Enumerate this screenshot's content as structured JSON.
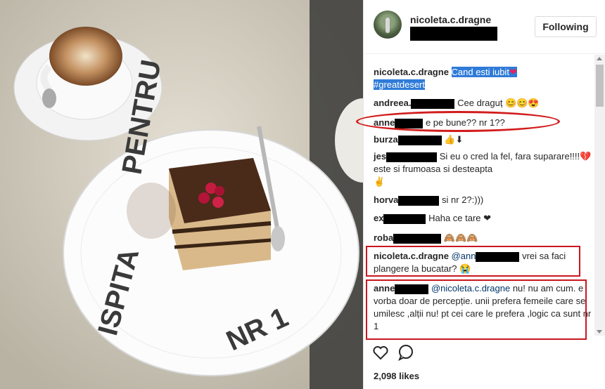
{
  "post": {
    "username": "nicoleta.c.dragne",
    "follow_label": "Following",
    "likes": "2,098 likes"
  },
  "plate_text": "PENTRU ISPITA NR 1",
  "caption": {
    "username": "nicoleta.c.dragne",
    "text": "Cand esti iubit",
    "heart": "❤",
    "hashtag": "#greatdesert"
  },
  "comments": [
    {
      "user": "andreea.",
      "text": "Cee draguț",
      "emoji": "😊😊😍"
    },
    {
      "user": "anne",
      "text": "e pe bune?? nr 1??"
    },
    {
      "user": "burza",
      "text": "",
      "emoji": "👍⬇"
    },
    {
      "user": "jes",
      "text": "Si eu o cred la fel, fara suparare!!!!",
      "tail": " este si frumoasa si desteapta",
      "emoji": "💔",
      "emoji2": "✌"
    },
    {
      "user": "horva",
      "text": "si nr 2?:)))"
    },
    {
      "user": "ex",
      "text": "Haha ce tare",
      "emoji": "❤"
    },
    {
      "user": "roba",
      "text": "",
      "emoji": "🙈🙈🙈"
    },
    {
      "user": "nicoleta.c.dragne",
      "mention": "@ann",
      "text": "vrei sa faci plangere la bucatar?",
      "emoji": "😭"
    },
    {
      "user": "anne",
      "mention": "@nicoleta.c.dragne",
      "text": "nu! nu am cum. e vorba doar de percepție. unii prefera femeile care se umilesc ,alții nu! pt cei care le prefera ,logic ca sunt nr 1"
    }
  ],
  "icons": {
    "like": "heart-outline-icon",
    "comment": "comment-bubble-icon"
  }
}
